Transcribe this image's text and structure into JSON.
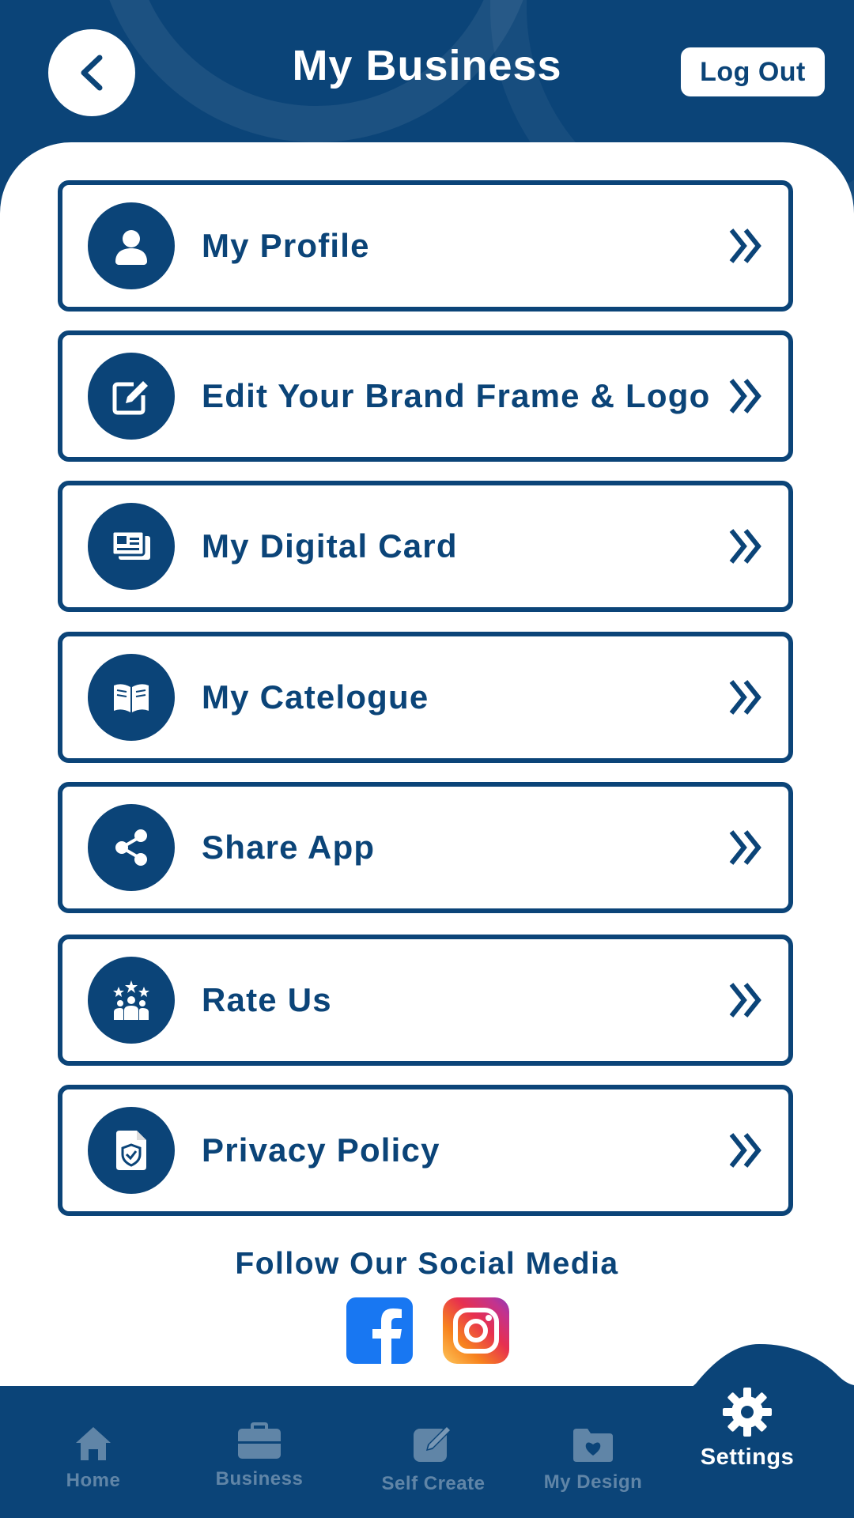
{
  "header": {
    "title": "My Business",
    "logout_label": "Log Out"
  },
  "menu": [
    {
      "label": "My Profile",
      "icon": "user-icon"
    },
    {
      "label": "Edit Your Brand Frame & Logo",
      "icon": "edit-icon"
    },
    {
      "label": "My Digital Card",
      "icon": "id-card-icon"
    },
    {
      "label": "My Catelogue",
      "icon": "book-icon"
    },
    {
      "label": "Share App",
      "icon": "share-icon"
    },
    {
      "label": "Rate Us",
      "icon": "rating-people-icon"
    },
    {
      "label": "Privacy Policy",
      "icon": "privacy-document-icon"
    }
  ],
  "social": {
    "title": "Follow Our Social Media",
    "icons": [
      "facebook-icon",
      "instagram-icon"
    ]
  },
  "nav": {
    "items": [
      {
        "label": "Home",
        "icon": "home-icon"
      },
      {
        "label": "Business",
        "icon": "briefcase-icon"
      },
      {
        "label": "Self Create",
        "icon": "create-icon"
      },
      {
        "label": "My Design",
        "icon": "folder-heart-icon"
      },
      {
        "label": "Settings",
        "icon": "gear-icon"
      }
    ],
    "active": "Settings"
  },
  "colors": {
    "primary": "#0b4478",
    "surface": "#ffffff",
    "facebook": "#1877f2"
  }
}
